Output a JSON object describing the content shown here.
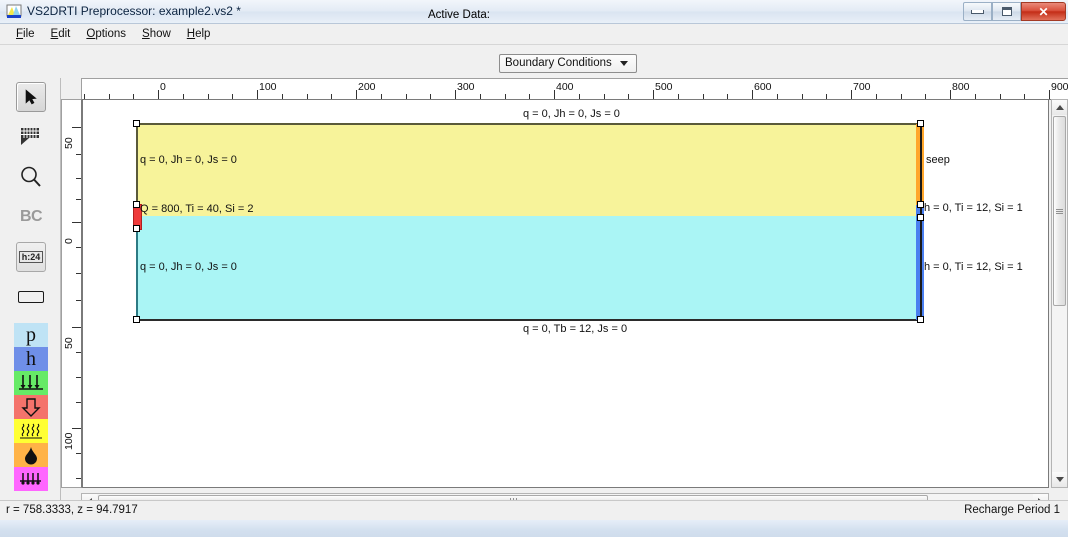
{
  "window": {
    "title": "VS2DRTI Preprocessor: example2.vs2 *",
    "icon": "app-icon",
    "controls": {
      "minimize": "minimize-button",
      "maximize": "maximize-button",
      "close": "✕"
    }
  },
  "menu": {
    "items": [
      {
        "label": "File"
      },
      {
        "label": "Edit"
      },
      {
        "label": "Options"
      },
      {
        "label": "Show"
      },
      {
        "label": "Help"
      }
    ]
  },
  "toolbar": {
    "active_data_label": "Active Data:",
    "active_data_value": "Boundary Conditions",
    "active_data_options": [
      "Boundary Conditions"
    ]
  },
  "tools": [
    {
      "name": "select-arrow-tool",
      "icon": "arrow-cursor-icon",
      "selected": true
    },
    {
      "name": "grid-tool",
      "icon": "grid-icon",
      "selected": false
    },
    {
      "name": "zoom-tool",
      "icon": "magnifier-icon",
      "selected": false
    },
    {
      "name": "boundary-conditions-tool",
      "icon": "bc-text-icon",
      "label": "BC",
      "selected": false,
      "disabled": true
    },
    {
      "name": "value-tool",
      "icon": "h24-icon",
      "label": "h:24",
      "selected": false
    },
    {
      "name": "rectangle-tool",
      "icon": "rectangle-icon",
      "selected": false
    }
  ],
  "palette": [
    {
      "name": "pressure-head-swatch",
      "label": "p",
      "color": "#bfe3f5",
      "icon": "p-letter-icon"
    },
    {
      "name": "total-head-swatch",
      "label": "h",
      "color": "#6f8fe8",
      "icon": "h-letter-icon"
    },
    {
      "name": "flux-swatch",
      "label": "",
      "color": "#66ea66",
      "icon": "down-arrows-icon"
    },
    {
      "name": "volumetric-flow-swatch",
      "label": "",
      "color": "#f4736b",
      "icon": "block-arrow-down-icon"
    },
    {
      "name": "evaporation-swatch",
      "label": "",
      "color": "#ffff33",
      "icon": "wavy-lines-icon"
    },
    {
      "name": "seepage-swatch",
      "label": "",
      "color": "#ffb347",
      "icon": "drop-icon"
    },
    {
      "name": "gravity-drain-swatch",
      "label": "",
      "color": "#ff66ff",
      "icon": "pins-icon"
    }
  ],
  "ruler": {
    "horizontal": {
      "labels": [
        "0",
        "100",
        "200",
        "300",
        "400",
        "500",
        "600",
        "700",
        "800",
        "900"
      ],
      "values": [
        0,
        100,
        200,
        300,
        400,
        500,
        600,
        700,
        800,
        900
      ]
    },
    "vertical": {
      "labels": [
        "50",
        "0",
        "50",
        "100"
      ],
      "values": [
        50,
        0,
        50,
        100
      ]
    }
  },
  "canvas": {
    "regions": [
      {
        "name": "upper-region",
        "color": "#f7f39a"
      },
      {
        "name": "lower-region",
        "color": "#aaf5f5"
      }
    ],
    "boundary_labels": {
      "top": "q = 0, Jh = 0, Js = 0",
      "left_upper": "q = 0, Jh = 0, Js = 0",
      "left_source": "Q = 800, Ti = 40, Si = 2",
      "left_lower": "q = 0, Jh = 0, Js = 0",
      "right_seep": "seep",
      "right_upper": "h = 0, Ti = 12, Si = 1",
      "right_lower": "h = 0, Ti = 12, Si = 1",
      "bottom": "q = 0, Tb = 12, Js = 0"
    },
    "edge_colors": {
      "source": "#ef3b3b",
      "seep": "#ffa62b",
      "head": "#4a7ff0",
      "plain": "#3a3a3a"
    }
  },
  "statusbar": {
    "coordinates": "r = 758.3333, z = 94.7917",
    "recharge_period": "Recharge Period 1"
  }
}
